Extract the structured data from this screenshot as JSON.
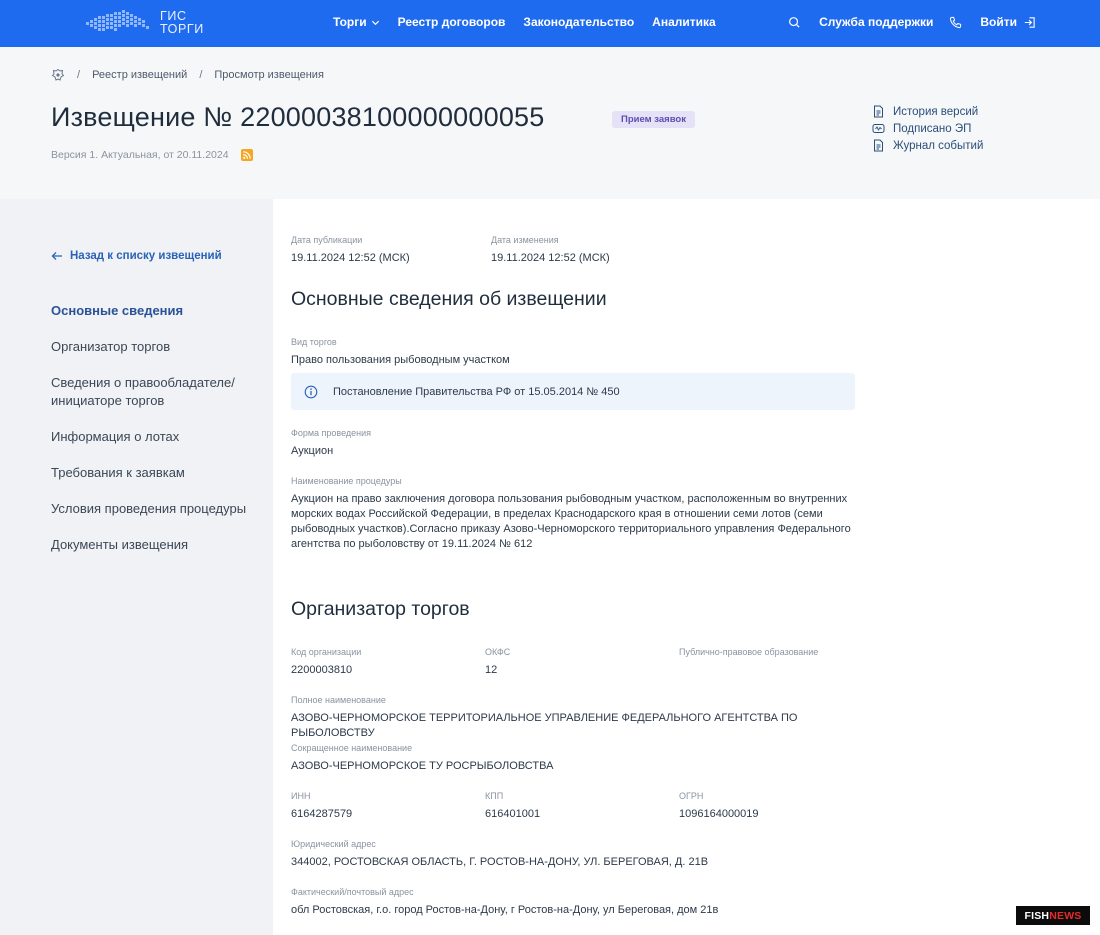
{
  "topbar": {
    "logo_line1": "ГИС",
    "logo_line2": "ТОРГИ",
    "nav": [
      {
        "label": "Торги"
      },
      {
        "label": "Реестр договоров"
      },
      {
        "label": "Законодательство"
      },
      {
        "label": "Аналитика"
      }
    ],
    "support_label": "Служба поддержки",
    "login_label": "Войти",
    "accent": "#1f6bf0"
  },
  "breadcrumb": {
    "items": [
      "Реестр извещений",
      "Просмотр извещения"
    ],
    "separator": "/"
  },
  "header": {
    "title": "Извещение № 22000038100000000055",
    "status_badge": "Прием заявок",
    "version": "Версия 1. Актуальная, от 20.11.2024",
    "links": [
      "История версий",
      "Подписано ЭП",
      "Журнал событий"
    ]
  },
  "sidebar": {
    "back_label": "Назад к списку извещений",
    "items": [
      {
        "label": "Основные сведения",
        "active": true
      },
      {
        "label": "Организатор торгов"
      },
      {
        "label": "Сведения о правообладателе/ инициаторе торгов"
      },
      {
        "label": "Информация о лотах"
      },
      {
        "label": "Требования к заявкам"
      },
      {
        "label": "Условия проведения процедуры"
      },
      {
        "label": "Документы извещения"
      }
    ]
  },
  "main": {
    "pub_date_label": "Дата публикации",
    "pub_date_value": "19.11.2024 12:52 (МСК)",
    "mod_date_label": "Дата изменения",
    "mod_date_value": "19.11.2024 12:52 (МСК)",
    "section1_title": "Основные сведения об извещении",
    "trade_type_label": "Вид торгов",
    "trade_type_value": "Право пользования рыбоводным участком",
    "info_note": "Постановление Правительства РФ от 15.05.2014 № 450",
    "form_label": "Форма проведения",
    "form_value": "Аукцион",
    "proc_name_label": "Наименование процедуры",
    "proc_name_value": "Аукцион на право заключения договора пользования рыбоводным участком, расположенным во внутренних морских водах Российской Федерации, в пределах Краснодарского края в отношении семи лотов (семи рыбоводных участков).Согласно приказу Азово-Черноморского территориального управления Федерального агентства по рыболовству от 19.11.2024 № 612",
    "section2_title": "Организатор торгов",
    "org_code_label": "Код организации",
    "org_code_value": "2200003810",
    "okfs_label": "ОКФС",
    "okfs_value": "12",
    "ppo_label": "Публично-правовое образование",
    "full_name_label": "Полное наименование",
    "full_name_value": "АЗОВО-ЧЕРНОМОРСКОЕ ТЕРРИТОРИАЛЬНОЕ УПРАВЛЕНИЕ ФЕДЕРАЛЬНОГО АГЕНТСТВА ПО РЫБОЛОВСТВУ",
    "short_name_label": "Сокращенное наименование",
    "short_name_value": "АЗОВО-ЧЕРНОМОРСКОЕ ТУ РОСРЫБОЛОВСТВА",
    "inn_label": "ИНН",
    "inn_value": "6164287579",
    "kpp_label": "КПП",
    "kpp_value": "616401001",
    "ogrn_label": "ОГРН",
    "ogrn_value": "1096164000019",
    "legal_addr_label": "Юридический адрес",
    "legal_addr_value": "344002, РОСТОВСКАЯ ОБЛАСТЬ, Г. РОСТОВ-НА-ДОНУ, УЛ. БЕРЕГОВАЯ, Д. 21В",
    "fact_addr_label": "Фактический/почтовый адрес",
    "fact_addr_value": "обл Ростовская, г.о. город Ростов-на-Дону, г Ростов-на-Дону, ул Береговая, дом 21в"
  },
  "watermark": {
    "part1": "FISH",
    "part2": "NEWS"
  }
}
